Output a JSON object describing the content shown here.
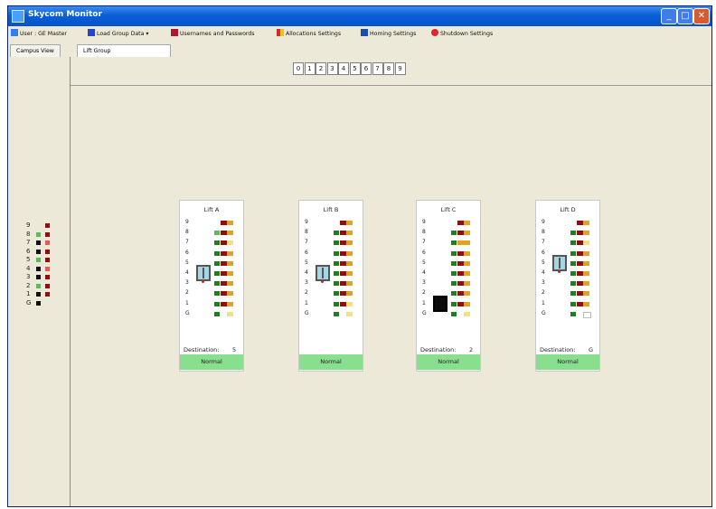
{
  "window": {
    "title": "Skycom Monitor",
    "minimize": "_",
    "maximize": "□",
    "close": "✕"
  },
  "menu": {
    "items": [
      {
        "label": "User : GE Master",
        "icon": "user-icon",
        "color": "#2f7cf5"
      },
      {
        "label": "Load Group Data ▾",
        "icon": "data-icon",
        "color": "#2745c2"
      },
      {
        "label": "Usernames and Passwords",
        "icon": "users-icon",
        "color": "#b0182a"
      },
      {
        "label": "Allocations Settings",
        "icon": "allocation-icon",
        "color": "#d12a2a"
      },
      {
        "label": "Homing Settings",
        "icon": "homing-icon",
        "color": "#1d4fa8"
      },
      {
        "label": "Shutdown Settings",
        "icon": "shutdown-icon",
        "color": "#e02626"
      }
    ]
  },
  "tabs": [
    {
      "label": "Campus View"
    },
    {
      "label": "Lift Group"
    }
  ],
  "floor_buttons": [
    "0",
    "1",
    "2",
    "3",
    "4",
    "5",
    "6",
    "7",
    "8",
    "9"
  ],
  "overview": {
    "floors": [
      "9",
      "8",
      "7",
      "6",
      "5",
      "4",
      "3",
      "2",
      "1",
      "G"
    ],
    "left_colors": [
      "none",
      "green_light",
      "green_dark",
      "green_dark",
      "green_light",
      "green_dark",
      "green_dark",
      "green_light",
      "green_dark",
      "green_dark"
    ],
    "right_colors": [
      "red",
      "red",
      "red_light",
      "red",
      "red",
      "red_light",
      "red",
      "red",
      "red",
      "none"
    ]
  },
  "lifts": [
    {
      "name": "Lift A",
      "floors": [
        "9",
        "8",
        "7",
        "6",
        "5",
        "4",
        "3",
        "2",
        "1",
        "G"
      ],
      "car_floor": "4",
      "car_style": "cyan",
      "destination_label": "Destination:",
      "destination": "5",
      "status": "Normal",
      "floor_indicators": [
        [
          "none",
          "red",
          "orange"
        ],
        [
          "green_light",
          "red",
          "orange"
        ],
        [
          "green",
          "red",
          "yellow"
        ],
        [
          "green",
          "red",
          "orange"
        ],
        [
          "green",
          "red",
          "orange"
        ],
        [
          "green",
          "red",
          "orange"
        ],
        [
          "green",
          "red",
          "orange"
        ],
        [
          "green",
          "red",
          "orange"
        ],
        [
          "green",
          "red",
          "orange"
        ],
        [
          "green",
          "none",
          "yellow"
        ]
      ]
    },
    {
      "name": "Lift B",
      "floors": [
        "9",
        "8",
        "7",
        "6",
        "5",
        "4",
        "3",
        "2",
        "1",
        "G"
      ],
      "car_floor": "4",
      "car_style": "cyan",
      "destination_label": "",
      "destination": "",
      "status": "Normal",
      "floor_indicators": [
        [
          "none",
          "red",
          "orange"
        ],
        [
          "green",
          "red",
          "orange"
        ],
        [
          "green",
          "red",
          "orange"
        ],
        [
          "green",
          "red",
          "orange"
        ],
        [
          "green",
          "red",
          "orange"
        ],
        [
          "green",
          "red",
          "orange"
        ],
        [
          "green",
          "red",
          "orange"
        ],
        [
          "green",
          "red",
          "orange"
        ],
        [
          "green",
          "red",
          "yellow"
        ],
        [
          "green",
          "none",
          "yellow"
        ]
      ]
    },
    {
      "name": "Lift C",
      "floors": [
        "9",
        "8",
        "7",
        "6",
        "5",
        "4",
        "3",
        "2",
        "1",
        "G"
      ],
      "car_floor": "1",
      "car_style": "black",
      "destination_label": "Destination:",
      "destination": "2",
      "status": "Normal",
      "floor_indicators": [
        [
          "none",
          "red",
          "orange"
        ],
        [
          "green",
          "red",
          "orange"
        ],
        [
          "green",
          "orange",
          "orange"
        ],
        [
          "green",
          "red",
          "orange"
        ],
        [
          "green",
          "red",
          "orange"
        ],
        [
          "green",
          "red",
          "orange"
        ],
        [
          "green",
          "red",
          "orange"
        ],
        [
          "green",
          "red",
          "orange"
        ],
        [
          "green",
          "red",
          "orange"
        ],
        [
          "green",
          "none",
          "yellow"
        ]
      ]
    },
    {
      "name": "Lift D",
      "floors": [
        "9",
        "8",
        "7",
        "6",
        "5",
        "4",
        "3",
        "2",
        "1",
        "G"
      ],
      "car_floor": "5",
      "car_style": "cyan",
      "destination_label": "Destination:",
      "destination": "G",
      "status": "Normal",
      "floor_indicators": [
        [
          "none",
          "red",
          "orange"
        ],
        [
          "green",
          "red",
          "orange"
        ],
        [
          "green",
          "red",
          "yellow"
        ],
        [
          "green",
          "red",
          "orange"
        ],
        [
          "green",
          "red",
          "orange"
        ],
        [
          "green",
          "red",
          "orange"
        ],
        [
          "green",
          "red",
          "orange"
        ],
        [
          "green",
          "red",
          "orange"
        ],
        [
          "green",
          "red",
          "orange"
        ],
        [
          "green",
          "none",
          "white"
        ]
      ]
    }
  ],
  "colors": {
    "green": "#1f7e1f",
    "green_dark": "#111111",
    "green_light": "#5fb85f",
    "red": "#8b1010",
    "red_light": "#e25a5a",
    "orange": "#e0a21f",
    "yellow": "#f2e27a",
    "white": "#ffffff",
    "status_bg": "#88e08f"
  }
}
